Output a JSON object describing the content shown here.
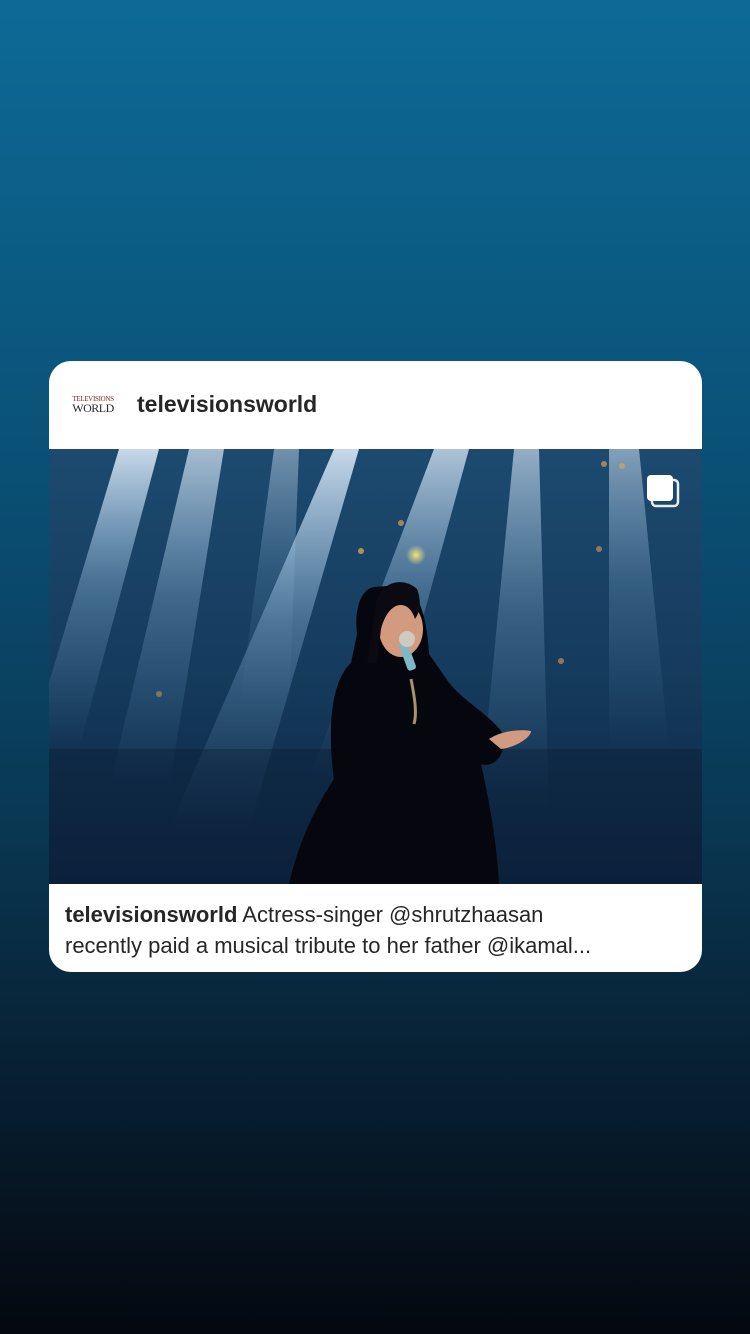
{
  "post": {
    "username": "televisionsworld",
    "logo": {
      "top_text": "TELEVISIONS",
      "bottom_text": "WORLD",
      "icon": "televisions-world-logo"
    },
    "media": {
      "icon": "carousel-multiple-icon"
    },
    "caption": {
      "username": "televisionsworld",
      "line1": "Actress-singer @shrutzhaasan",
      "line2": "recently paid a musical tribute to her father @ikamal..."
    }
  },
  "colors": {
    "background_top": "#0d6a96",
    "background_bottom": "#04080f",
    "card": "#ffffff",
    "text": "#262626"
  }
}
